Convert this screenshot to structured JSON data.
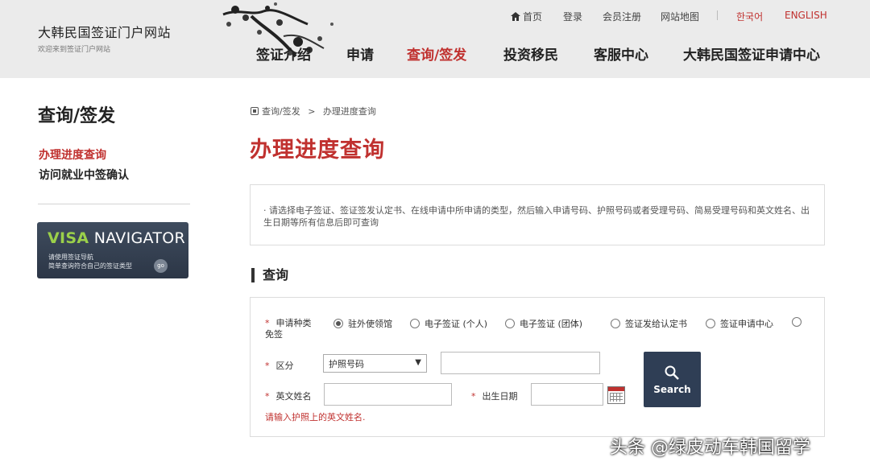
{
  "header": {
    "site_title": "大韩民国签证门户网站",
    "site_subtitle": "欢迎来到签证门户网站",
    "utility": {
      "home": "首页",
      "login": "登录",
      "signup": "会员注册",
      "sitemap": "网站地图",
      "korean": "한국어",
      "english": "ENGLISH"
    },
    "nav": [
      "签证介绍",
      "申请",
      "查询/签发",
      "投资移民",
      "客服中心",
      "大韩民国签证申请中心"
    ],
    "active_nav": "查询/签发"
  },
  "sidebar": {
    "title": "查询/签发",
    "items": [
      {
        "label": "办理进度查询",
        "active": true
      },
      {
        "label": "访问就业中签确认",
        "active": false
      }
    ],
    "banner": {
      "visa": "VISA",
      "navigator": " NAVIGATOR",
      "line1": "请使用签证导航",
      "line2": "简单查询符合自己的签证类型",
      "go": "go"
    }
  },
  "breadcrumb": {
    "section": "查询/签发",
    "separator": ">",
    "current": "办理进度查询"
  },
  "page_title": "办理进度查询",
  "notice": "· 请选择电子签证、签证签发认定书、在线申请中所申请的类型，然后输入申请号码、护照号码或者受理号码、简易受理号码和英文姓名、出生日期等所有信息后即可查询",
  "section_title": "查询",
  "form": {
    "required_mark": "*",
    "type_label": "申请种类",
    "types": [
      {
        "label": "驻外使领馆",
        "checked": true
      },
      {
        "label": "电子签证 (个人)",
        "checked": false
      },
      {
        "label": "电子签证 (团体)",
        "checked": false
      },
      {
        "label": "签证发给认定书",
        "checked": false
      },
      {
        "label": "签证申请中心",
        "checked": false
      },
      {
        "label": "免签",
        "checked": false
      }
    ],
    "category_label": "区分",
    "category_selected": "护照号码",
    "name_label": "英文姓名",
    "birth_label": "出生日期",
    "search_label": "Search",
    "hint": "请输入护照上的英文姓名."
  },
  "watermark": "头条 @绿皮动车韩国留学",
  "colors": {
    "accent": "#c0312f",
    "button": "#2f3e55",
    "header_bg": "#ebebeb"
  }
}
